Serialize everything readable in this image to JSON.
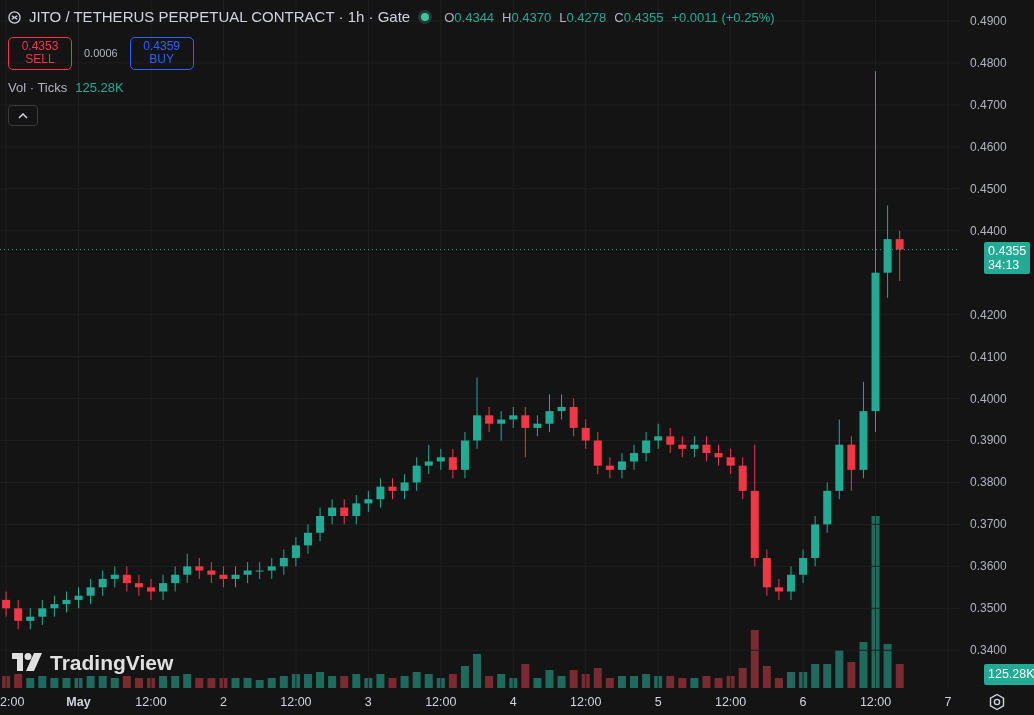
{
  "legend": {
    "title": "JITO / TETHERUS PERPETUAL CONTRACT · 1h · Gate",
    "ohlc": [
      {
        "label": "O",
        "value": "0.4344"
      },
      {
        "label": "H",
        "value": "0.4370"
      },
      {
        "label": "L",
        "value": "0.4278"
      },
      {
        "label": "C",
        "value": "0.4355"
      }
    ],
    "change": "+0.0011 (+0.25%)"
  },
  "trade": {
    "sell": {
      "price": "0.4353",
      "label": "SELL"
    },
    "spread": "0.0006",
    "buy": {
      "price": "0.4359",
      "label": "BUY"
    }
  },
  "volume_indicator": {
    "name": "Vol · Ticks",
    "value": "125.28K"
  },
  "chart": {
    "chart_data": {
      "type": "candlestick",
      "x": [
        0.5,
        0.5833,
        0.6667,
        0.75,
        0.8333,
        0.9167,
        1,
        1.0833,
        1.1667,
        1.25,
        1.3333,
        1.4167,
        1.5,
        1.5833,
        1.6667,
        1.75,
        1.8333,
        1.9167,
        2,
        2.0833,
        2.1667,
        2.25,
        2.3333,
        2.4167,
        2.5,
        2.5833,
        2.6667,
        2.75,
        2.8333,
        2.9167,
        3,
        3.0833,
        3.1667,
        3.25,
        3.3333,
        3.4167,
        3.5,
        3.5833,
        3.6667,
        3.75,
        3.8333,
        3.9167,
        4,
        4.0833,
        4.1667,
        4.25,
        4.3333,
        4.4167,
        4.5,
        4.5833,
        4.6667,
        4.75,
        4.8333,
        4.9167,
        5,
        5.0833,
        5.1667,
        5.25,
        5.3333,
        5.4167,
        5.5,
        5.5833,
        5.6667,
        5.75,
        5.8333,
        5.9167,
        6,
        6.0833,
        6.1667,
        6.25,
        6.3333,
        6.4167,
        6.5,
        6.5833,
        6.6667
      ],
      "ohlc": [
        [
          0.352,
          0.354,
          0.348,
          0.35
        ],
        [
          0.35,
          0.352,
          0.345,
          0.347
        ],
        [
          0.347,
          0.35,
          0.345,
          0.348
        ],
        [
          0.348,
          0.352,
          0.346,
          0.35
        ],
        [
          0.35,
          0.353,
          0.348,
          0.351
        ],
        [
          0.351,
          0.354,
          0.349,
          0.352
        ],
        [
          0.352,
          0.355,
          0.35,
          0.353
        ],
        [
          0.353,
          0.357,
          0.351,
          0.355
        ],
        [
          0.355,
          0.359,
          0.353,
          0.357
        ],
        [
          0.357,
          0.36,
          0.355,
          0.358
        ],
        [
          0.358,
          0.36,
          0.354,
          0.356
        ],
        [
          0.356,
          0.358,
          0.353,
          0.355
        ],
        [
          0.355,
          0.357,
          0.352,
          0.354
        ],
        [
          0.354,
          0.358,
          0.352,
          0.356
        ],
        [
          0.356,
          0.36,
          0.354,
          0.358
        ],
        [
          0.358,
          0.363,
          0.356,
          0.36
        ],
        [
          0.36,
          0.362,
          0.357,
          0.359
        ],
        [
          0.359,
          0.361,
          0.356,
          0.358
        ],
        [
          0.358,
          0.36,
          0.355,
          0.357
        ],
        [
          0.357,
          0.36,
          0.355,
          0.358
        ],
        [
          0.358,
          0.361,
          0.356,
          0.359
        ],
        [
          0.359,
          0.361,
          0.357,
          0.359
        ],
        [
          0.359,
          0.362,
          0.357,
          0.36
        ],
        [
          0.36,
          0.364,
          0.358,
          0.362
        ],
        [
          0.362,
          0.367,
          0.36,
          0.365
        ],
        [
          0.365,
          0.37,
          0.363,
          0.368
        ],
        [
          0.368,
          0.374,
          0.366,
          0.372
        ],
        [
          0.372,
          0.376,
          0.37,
          0.374
        ],
        [
          0.374,
          0.376,
          0.37,
          0.372
        ],
        [
          0.372,
          0.377,
          0.37,
          0.375
        ],
        [
          0.375,
          0.378,
          0.373,
          0.376
        ],
        [
          0.376,
          0.381,
          0.374,
          0.379
        ],
        [
          0.379,
          0.381,
          0.376,
          0.378
        ],
        [
          0.378,
          0.382,
          0.376,
          0.38
        ],
        [
          0.38,
          0.386,
          0.378,
          0.384
        ],
        [
          0.384,
          0.389,
          0.382,
          0.385
        ],
        [
          0.385,
          0.388,
          0.383,
          0.386
        ],
        [
          0.386,
          0.388,
          0.381,
          0.383
        ],
        [
          0.383,
          0.392,
          0.381,
          0.39
        ],
        [
          0.39,
          0.405,
          0.388,
          0.396
        ],
        [
          0.396,
          0.398,
          0.392,
          0.394
        ],
        [
          0.394,
          0.397,
          0.39,
          0.395
        ],
        [
          0.395,
          0.398,
          0.393,
          0.396
        ],
        [
          0.396,
          0.398,
          0.386,
          0.393
        ],
        [
          0.393,
          0.396,
          0.391,
          0.394
        ],
        [
          0.394,
          0.401,
          0.392,
          0.397
        ],
        [
          0.397,
          0.401,
          0.395,
          0.398
        ],
        [
          0.398,
          0.4,
          0.391,
          0.393
        ],
        [
          0.393,
          0.395,
          0.388,
          0.39
        ],
        [
          0.39,
          0.392,
          0.382,
          0.384
        ],
        [
          0.384,
          0.386,
          0.381,
          0.383
        ],
        [
          0.383,
          0.387,
          0.381,
          0.385
        ],
        [
          0.385,
          0.389,
          0.383,
          0.387
        ],
        [
          0.387,
          0.392,
          0.385,
          0.39
        ],
        [
          0.39,
          0.394,
          0.388,
          0.391
        ],
        [
          0.391,
          0.393,
          0.387,
          0.389
        ],
        [
          0.389,
          0.391,
          0.386,
          0.388
        ],
        [
          0.388,
          0.391,
          0.386,
          0.389
        ],
        [
          0.389,
          0.391,
          0.385,
          0.387
        ],
        [
          0.387,
          0.389,
          0.384,
          0.386
        ],
        [
          0.386,
          0.388,
          0.382,
          0.384
        ],
        [
          0.384,
          0.386,
          0.376,
          0.378
        ],
        [
          0.378,
          0.389,
          0.36,
          0.362
        ],
        [
          0.362,
          0.364,
          0.353,
          0.355
        ],
        [
          0.355,
          0.357,
          0.352,
          0.354
        ],
        [
          0.354,
          0.36,
          0.352,
          0.358
        ],
        [
          0.358,
          0.364,
          0.356,
          0.362
        ],
        [
          0.362,
          0.372,
          0.36,
          0.37
        ],
        [
          0.37,
          0.38,
          0.368,
          0.378
        ],
        [
          0.378,
          0.395,
          0.376,
          0.389
        ],
        [
          0.389,
          0.391,
          0.378,
          0.383
        ],
        [
          0.383,
          0.404,
          0.381,
          0.397
        ],
        [
          0.397,
          0.478,
          0.392,
          0.43
        ],
        [
          0.43,
          0.446,
          0.424,
          0.438
        ],
        [
          0.438,
          0.44,
          0.428,
          0.4355
        ]
      ],
      "ylim": [
        0.331,
        0.495
      ],
      "grid": true,
      "ref_lines": [
        {
          "axis": "y",
          "value": 0.4355
        }
      ],
      "yticks": [
        {
          "value": 0.49,
          "label": "0.4900"
        },
        {
          "value": 0.48,
          "label": "0.4800"
        },
        {
          "value": 0.47,
          "label": "0.4700"
        },
        {
          "value": 0.46,
          "label": "0.4600"
        },
        {
          "value": 0.45,
          "label": "0.4500"
        },
        {
          "value": 0.44,
          "label": "0.4400"
        },
        {
          "value": 0.42,
          "label": "0.4200"
        },
        {
          "value": 0.41,
          "label": "0.4100"
        },
        {
          "value": 0.4,
          "label": "0.4000"
        },
        {
          "value": 0.39,
          "label": "0.3900"
        },
        {
          "value": 0.38,
          "label": "0.3800"
        },
        {
          "value": 0.37,
          "label": "0.3700"
        },
        {
          "value": 0.36,
          "label": "0.3600"
        },
        {
          "value": 0.35,
          "label": "0.3500"
        },
        {
          "value": 0.34,
          "label": "0.3400"
        }
      ],
      "xlim": [
        0.458,
        7.083
      ],
      "xticks": [
        {
          "value": 1,
          "label": "May"
        },
        {
          "value": 2,
          "label": "2"
        },
        {
          "value": 3,
          "label": "3"
        },
        {
          "value": 4,
          "label": "4"
        },
        {
          "value": 5,
          "label": "5"
        },
        {
          "value": 6,
          "label": "6"
        },
        {
          "value": 7,
          "label": "7"
        }
      ]
    },
    "midday_labels": [
      "2:00",
      "12:00",
      "12:00",
      "12:00",
      "12:00",
      "12:00",
      "12:00"
    ]
  },
  "price_label": {
    "price": "0.4355",
    "countdown": "34:13"
  },
  "volume_label": "125.28K",
  "logo": "TradingView"
}
